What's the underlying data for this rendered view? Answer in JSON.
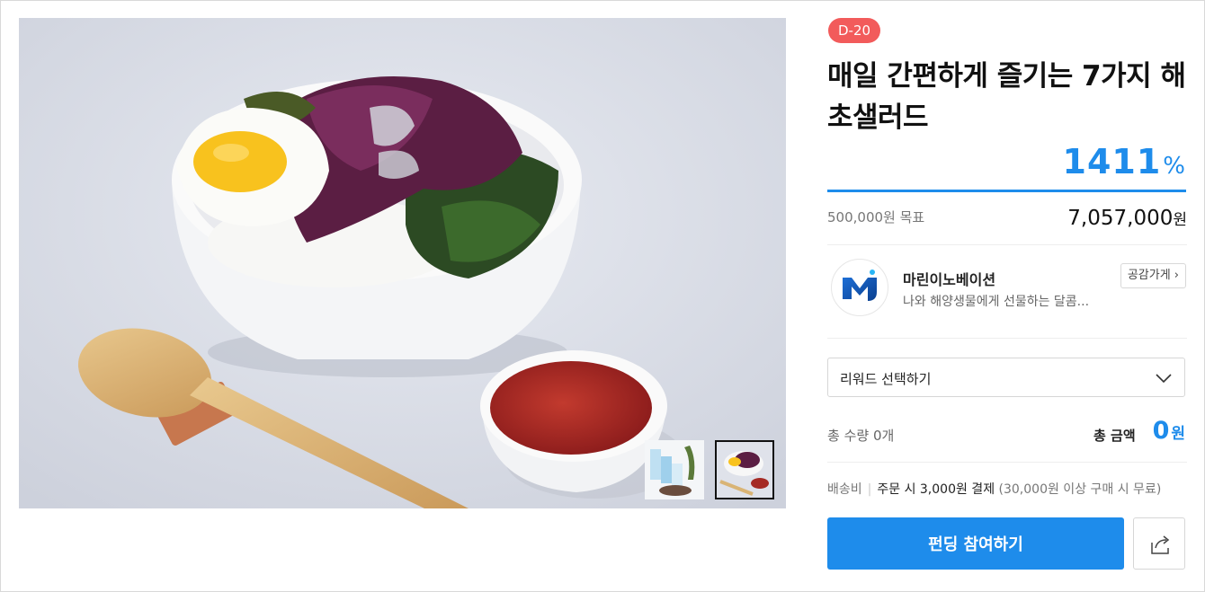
{
  "project": {
    "d_day_badge": "D-20",
    "title": "매일 간편하게 즐기는 7가지 해초샐러드",
    "achievement_rate": "1411",
    "achievement_unit": "%",
    "progress_fraction": 1.0,
    "goal_amount": "500,000",
    "goal_unit": "원 목표",
    "raised_amount": "7,057,000",
    "raised_unit": "원"
  },
  "maker": {
    "name": "마린이노베이션",
    "description": "나와 해양생물에게 선물하는 달콤...",
    "follow_label": "공감가게",
    "logo_icon": "marine-innovation-logo"
  },
  "reward_select": {
    "placeholder": "리워드 선택하기"
  },
  "summary": {
    "quantity_label": "총 수량",
    "quantity_value": "0개",
    "amount_label": "총 금액",
    "amount_value": "0",
    "amount_unit": "원"
  },
  "shipping": {
    "label": "배송비",
    "value": "주문 시 3,000원 결제",
    "note": "(30,000원 이상 구매 시 무료)"
  },
  "actions": {
    "fund_label": "펀딩 참여하기",
    "share_icon": "share-icon"
  },
  "colors": {
    "accent": "#1e8ceb",
    "badge": "#f25b5b"
  }
}
